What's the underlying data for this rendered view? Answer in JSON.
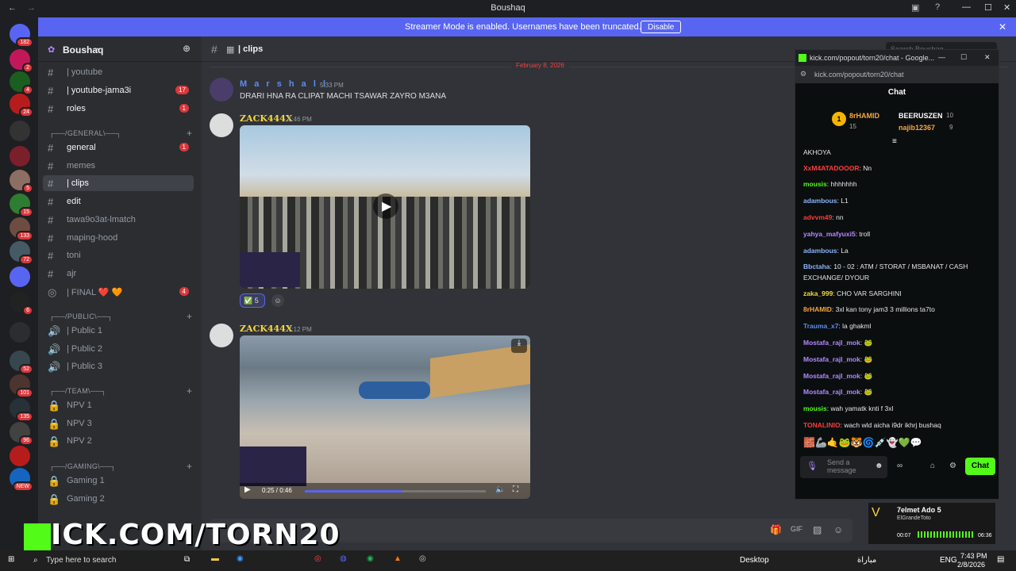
{
  "window": {
    "title": "Boushaq"
  },
  "banner": {
    "text": "Streamer Mode is enabled. Usernames have been truncated.",
    "button": "Disable"
  },
  "servers": [
    {
      "badge": "182",
      "color": "#5865f2"
    },
    {
      "badge": "2",
      "color": "#c2185b"
    },
    {
      "badge": "4",
      "color": "#1b5e20"
    },
    {
      "badge": "24",
      "color": "#b71c1c"
    },
    {
      "badge": "",
      "color": "#333"
    },
    {
      "badge": "",
      "color": "#7b1f2b"
    },
    {
      "badge": "5",
      "color": "#8d6e63"
    },
    {
      "badge": "15",
      "color": "#2e7d32"
    },
    {
      "badge": "133",
      "color": "#6d4c41"
    },
    {
      "badge": "72",
      "color": "#455a64"
    },
    {
      "badge": "",
      "color": "#5865f2"
    },
    {
      "badge": "6",
      "color": "#222"
    },
    {
      "badge": "",
      "color": "#2b2d31"
    },
    {
      "badge": "52",
      "color": "#37474f"
    },
    {
      "badge": "101",
      "color": "#4e342e"
    },
    {
      "badge": "135",
      "color": "#263238"
    },
    {
      "badge": "96",
      "color": "#424242"
    },
    {
      "badge": "",
      "color": "#b71c1c"
    },
    {
      "badge": "NEW",
      "color": "#1565c0"
    }
  ],
  "server_header": {
    "name": "Boushaq"
  },
  "channels": [
    {
      "name": "| youtube",
      "emoji": "❤️",
      "unread": false,
      "count": ""
    },
    {
      "name": "| youtube-jama3i",
      "emoji": "❤️",
      "unread": true,
      "count": "17"
    },
    {
      "name": "roles",
      "emoji": "",
      "unread": true,
      "count": "1"
    }
  ],
  "categories": {
    "general": "┌──/GENERAL\\──┐",
    "public": "┌──/PUBLIC\\──┐",
    "team": "┌──/TEAM\\──┐",
    "gaming": "┌──/GAMING\\──┐"
  },
  "general_channels": [
    {
      "name": "general",
      "emoji": "🔲",
      "unread": true,
      "count": "1"
    },
    {
      "name": "memes",
      "emoji": "😂",
      "unread": false,
      "count": ""
    },
    {
      "name": "| clips",
      "emoji": "🎬",
      "unread": false,
      "count": "",
      "selected": true
    },
    {
      "name": "edit",
      "emoji": "✏️",
      "unread": true,
      "count": ""
    },
    {
      "name": "tawa9o3at-lmatch",
      "emoji": "⚽",
      "unread": false,
      "count": ""
    },
    {
      "name": "maping-hood",
      "emoji": "🏠",
      "unread": false,
      "count": ""
    },
    {
      "name": "toni",
      "emoji": "🎁",
      "unread": false,
      "count": ""
    },
    {
      "name": "ajr",
      "emoji": "📄",
      "unread": false,
      "count": ""
    },
    {
      "name": "| FINAL ❤️ 🧡",
      "emoji": "⚽",
      "unread": false,
      "count": "4"
    }
  ],
  "public_channels": [
    "| Public 1",
    "| Public 2",
    "| Public 3"
  ],
  "team_channels": [
    "NPV 1",
    "NPV 3",
    "NPV 2"
  ],
  "gaming_channels": [
    "Gaming 1",
    "Gaming 2"
  ],
  "topbar": {
    "channel": "| clips",
    "search": "Search Boushaq"
  },
  "date_divider": "February 8, 2026",
  "messages": [
    {
      "user": "M a r s h a l l",
      "time": "5:33 PM",
      "text": "DRARI HNA RA CLIPAT MACHI TSAWAR ZAYRO M3ANA",
      "color": "#5b8def"
    },
    {
      "user": "ZACK444X",
      "time": "5:46 PM",
      "text": "",
      "color": "#f5d742",
      "reaction": "5"
    },
    {
      "user": "ZACK444X",
      "time": "7:12 PM",
      "text": "",
      "color": "#f5d742",
      "video_time": "0:25 / 0:46"
    }
  ],
  "kick": {
    "window_title": "kick.com/popout/torn20/chat - Google...",
    "url": "kick.com/popout/torn20/chat",
    "chat_title": "Chat",
    "leaders": [
      {
        "name": "8rHAMID",
        "count": "15"
      },
      {
        "name": "BEERUSZEN",
        "count": "10"
      },
      {
        "name": "najib12367",
        "count": "9"
      }
    ],
    "messages": [
      {
        "user": "",
        "text": "AKHOYA",
        "color": "#e6e6e6"
      },
      {
        "user": "XxM4ATADOOOR",
        "text": ": Nn",
        "color": "#ff3b3b"
      },
      {
        "user": "mousis",
        "text": ": hhhhhhh",
        "color": "#53fc18"
      },
      {
        "user": "adambous",
        "text": ": L1",
        "color": "#8ab4f8"
      },
      {
        "user": "advvm49",
        "text": ": nn",
        "color": "#ff3b3b"
      },
      {
        "user": "yahya_mafyuxi5",
        "text": ": troll",
        "color": "#b388ff"
      },
      {
        "user": "adambous",
        "text": ": La",
        "color": "#8ab4f8"
      },
      {
        "user": "Bbctaha",
        "text": ": 10 - 02 : ATM / STORAT / MSBANAT / CASH EXCHANGE/ DYOUR",
        "color": "#8ab4f8"
      },
      {
        "user": "zaka_999",
        "text": ": CHO VAR SARGHINI",
        "color": "#f5d742"
      },
      {
        "user": "8rHAMID",
        "text": ": 3xl kan tony jam3 3 millions ta7to",
        "color": "#f5a742"
      },
      {
        "user": "Trauma_x7",
        "text": ": la ghakml",
        "color": "#5b8def"
      },
      {
        "user": "Mostafa_rajl_mok",
        "text": ": 🐸",
        "color": "#b388ff"
      },
      {
        "user": "Mostafa_rajl_mok",
        "text": ": 🐸",
        "color": "#b388ff"
      },
      {
        "user": "Mostafa_rajl_mok",
        "text": ": 🐸",
        "color": "#b388ff"
      },
      {
        "user": "Mostafa_rajl_mok",
        "text": ": 🐸",
        "color": "#b388ff"
      },
      {
        "user": "mousis",
        "text": ": wah yamatk knti f 3xl",
        "color": "#53fc18"
      },
      {
        "user": "TONALINIO",
        "text": ": wach wld aicha i9dr ikhrj bushaq",
        "color": "#ff3b3b"
      }
    ],
    "input_placeholder": "Send a message",
    "send": "Chat"
  },
  "overlay": {
    "text": "ICK.COM/TORN20"
  },
  "music": {
    "title": "7elmet Ado 5",
    "artist": "ElGrandeToto",
    "elapsed": "00:07",
    "total": "06:36"
  },
  "taskbar": {
    "search": "Type here to search",
    "desktop": "Desktop",
    "lang": "ENG",
    "time": "7:43 PM",
    "date": "2/8/2026",
    "arabic": "مباراة"
  }
}
